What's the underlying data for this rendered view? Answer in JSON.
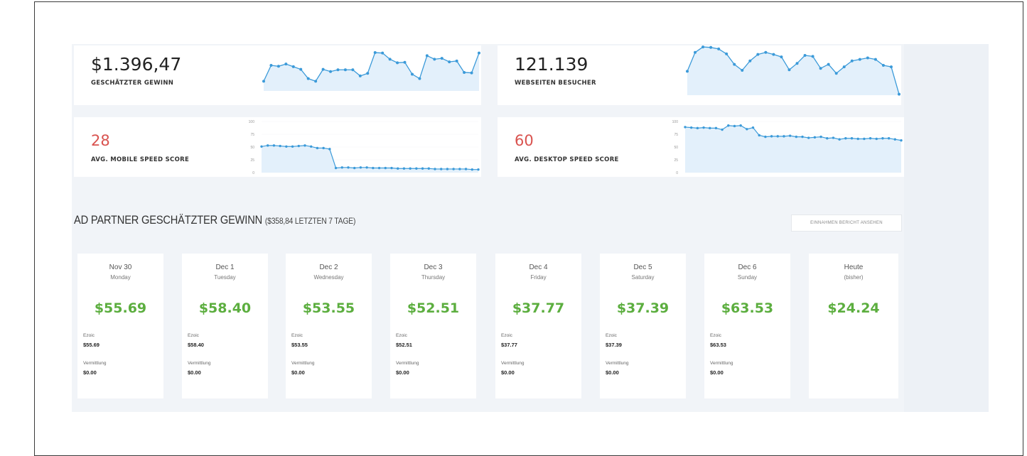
{
  "stats": {
    "profit": {
      "value": "$1.396,47",
      "label": "GESCHÄTZTER GEWINN",
      "spark": [
        22,
        58,
        56,
        61,
        55,
        49,
        28,
        22,
        49,
        44,
        48,
        48,
        48,
        34,
        40,
        87,
        86,
        72,
        64,
        65,
        38,
        28,
        80,
        72,
        74,
        66,
        68,
        42,
        41,
        86
      ]
    },
    "visitors": {
      "value": "121.139",
      "label": "WEBSEITEN BESUCHER",
      "spark": [
        48,
        86,
        97,
        96,
        93,
        83,
        62,
        50,
        69,
        82,
        86,
        82,
        77,
        51,
        64,
        80,
        78,
        54,
        62,
        44,
        57,
        69,
        72,
        75,
        72,
        60,
        57,
        2
      ]
    }
  },
  "speed": {
    "y_ticks": [
      "100",
      "75",
      "50",
      "25",
      "0"
    ],
    "mobile": {
      "value": "28",
      "label": "AVG. MOBILE SPEED SCORE",
      "points": [
        51,
        53,
        53,
        52,
        51,
        51,
        52,
        53,
        51,
        48,
        48,
        46,
        9,
        10,
        10,
        9,
        10,
        10,
        9,
        9,
        9,
        9,
        8,
        8,
        8,
        8,
        8,
        8,
        7,
        7,
        7,
        7,
        7,
        7,
        6,
        6
      ]
    },
    "desktop": {
      "value": "60",
      "label": "AVG. DESKTOP SPEED SCORE",
      "points": [
        89,
        88,
        87,
        88,
        87,
        87,
        84,
        92,
        91,
        92,
        85,
        88,
        73,
        70,
        71,
        71,
        71,
        72,
        70,
        70,
        68,
        69,
        70,
        67,
        68,
        65,
        67,
        67,
        66,
        66,
        67,
        66,
        67,
        67,
        65,
        63
      ]
    }
  },
  "section": {
    "title": "AD PARTNER GESCHÄTZTER GEWINN",
    "subtitle": "($358,84 LETZTEN 7 TAGE)",
    "report_button": "EINNAHMEN BERICHT ANSEHEN"
  },
  "days": [
    {
      "date": "Nov 30",
      "weekday": "Monday",
      "amount": "$55.69",
      "ezoic_label": "Ezoic",
      "ezoic": "$55.69",
      "verm_label": "Vermittlung",
      "verm": "$0.00"
    },
    {
      "date": "Dec 1",
      "weekday": "Tuesday",
      "amount": "$58.40",
      "ezoic_label": "Ezoic",
      "ezoic": "$58.40",
      "verm_label": "Vermittlung",
      "verm": "$0.00"
    },
    {
      "date": "Dec 2",
      "weekday": "Wednesday",
      "amount": "$53.55",
      "ezoic_label": "Ezoic",
      "ezoic": "$53.55",
      "verm_label": "Vermittlung",
      "verm": "$0.00"
    },
    {
      "date": "Dec 3",
      "weekday": "Thursday",
      "amount": "$52.51",
      "ezoic_label": "Ezoic",
      "ezoic": "$52.51",
      "verm_label": "Vermittlung",
      "verm": "$0.00"
    },
    {
      "date": "Dec 4",
      "weekday": "Friday",
      "amount": "$37.77",
      "ezoic_label": "Ezoic",
      "ezoic": "$37.77",
      "verm_label": "Vermittlung",
      "verm": "$0.00"
    },
    {
      "date": "Dec 5",
      "weekday": "Saturday",
      "amount": "$37.39",
      "ezoic_label": "Ezoic",
      "ezoic": "$37.39",
      "verm_label": "Vermittlung",
      "verm": "$0.00"
    },
    {
      "date": "Dec 6",
      "weekday": "Sunday",
      "amount": "$63.53",
      "ezoic_label": "Ezoic",
      "ezoic": "$63.53",
      "verm_label": "Vermittlung",
      "verm": "$0.00"
    },
    {
      "date": "Heute",
      "weekday": "(bisher)",
      "amount": "$24.24"
    }
  ],
  "colors": {
    "accent_line": "#3b9ad9",
    "area_fill": "#e3f0fb",
    "positive": "#5cae3f",
    "speed_value": "#d9534f"
  }
}
